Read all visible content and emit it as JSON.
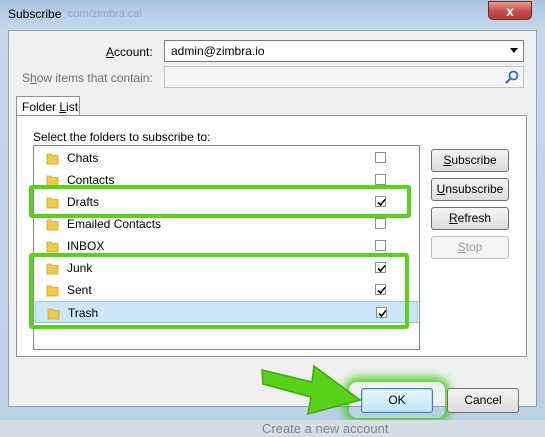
{
  "window": {
    "title": "Subscribe",
    "title_ghost": "com/zimbra.cal",
    "close_label": "x"
  },
  "account": {
    "label_prefix": "",
    "label_underlined": "A",
    "label_rest": "ccount:",
    "value": "admin@zimbra.io"
  },
  "filter": {
    "label_prefix": "S",
    "label_underlined": "h",
    "label_rest": "ow items that contain:",
    "value": ""
  },
  "tab": {
    "label_prefix": "Folder ",
    "label_underlined": "L",
    "label_rest": "ist"
  },
  "list": {
    "instruction": "Select the folders to subscribe to:",
    "folders": [
      {
        "name": "Chats",
        "checked": false,
        "selected": false
      },
      {
        "name": "Contacts",
        "checked": false,
        "selected": false
      },
      {
        "name": "Drafts",
        "checked": true,
        "selected": false
      },
      {
        "name": "Emailed Contacts",
        "checked": false,
        "selected": false
      },
      {
        "name": "INBOX",
        "checked": false,
        "selected": false
      },
      {
        "name": "Junk",
        "checked": true,
        "selected": false
      },
      {
        "name": "Sent",
        "checked": true,
        "selected": false
      },
      {
        "name": "Trash",
        "checked": true,
        "selected": true
      }
    ]
  },
  "buttons": {
    "subscribe": {
      "underlined": "S",
      "rest": "ubscribe"
    },
    "unsubscribe": {
      "underlined": "U",
      "rest": "nsubscribe"
    },
    "refresh": {
      "underlined": "R",
      "rest": "efresh"
    },
    "stop": {
      "underlined": "S",
      "rest": "top"
    },
    "ok": "OK",
    "cancel": "Cancel"
  },
  "background_text": "Create a new account",
  "colors": {
    "highlight": "#5ad21a",
    "selected_row": "#cde6f7",
    "folder": "#f2c94c"
  }
}
